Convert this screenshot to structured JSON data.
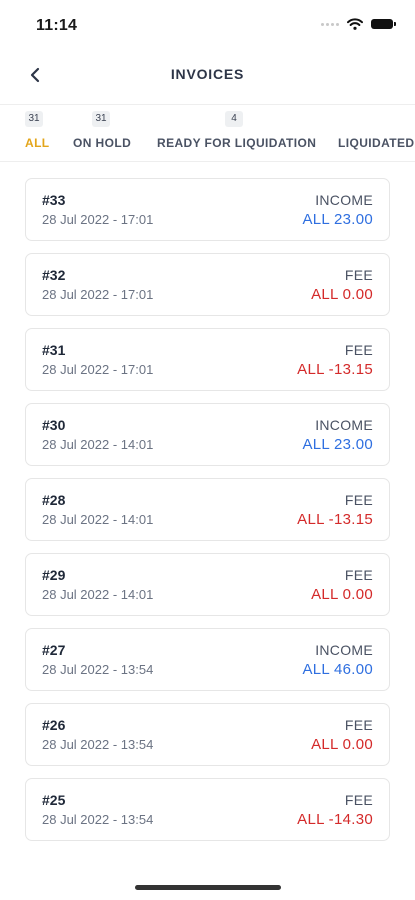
{
  "status_bar": {
    "time": "11:14"
  },
  "header": {
    "title": "INVOICES"
  },
  "tabs": [
    {
      "count": "31",
      "label": "ALL",
      "active": true
    },
    {
      "count": "31",
      "label": "ON HOLD",
      "active": false
    },
    {
      "count": "4",
      "label": "READY FOR LIQUIDATION",
      "active": false
    },
    {
      "count": "",
      "label": "LIQUIDATED",
      "active": false
    }
  ],
  "invoices": [
    {
      "number": "#33",
      "date": "28 Jul 2022 - 17:01",
      "type": "INCOME",
      "amount": "ALL 23.00"
    },
    {
      "number": "#32",
      "date": "28 Jul 2022 - 17:01",
      "type": "FEE",
      "amount": "ALL 0.00"
    },
    {
      "number": "#31",
      "date": "28 Jul 2022 - 17:01",
      "type": "FEE",
      "amount": "ALL -13.15"
    },
    {
      "number": "#30",
      "date": "28 Jul 2022 - 14:01",
      "type": "INCOME",
      "amount": "ALL 23.00"
    },
    {
      "number": "#28",
      "date": "28 Jul 2022 - 14:01",
      "type": "FEE",
      "amount": "ALL -13.15"
    },
    {
      "number": "#29",
      "date": "28 Jul 2022 - 14:01",
      "type": "FEE",
      "amount": "ALL 0.00"
    },
    {
      "number": "#27",
      "date": "28 Jul 2022 - 13:54",
      "type": "INCOME",
      "amount": "ALL 46.00"
    },
    {
      "number": "#26",
      "date": "28 Jul 2022 - 13:54",
      "type": "FEE",
      "amount": "ALL 0.00"
    },
    {
      "number": "#25",
      "date": "28 Jul 2022 - 13:54",
      "type": "FEE",
      "amount": "ALL -14.30"
    }
  ],
  "colors": {
    "active_tab": "#e3a51a",
    "income": "#2f6fe0",
    "fee": "#d42a2a"
  }
}
